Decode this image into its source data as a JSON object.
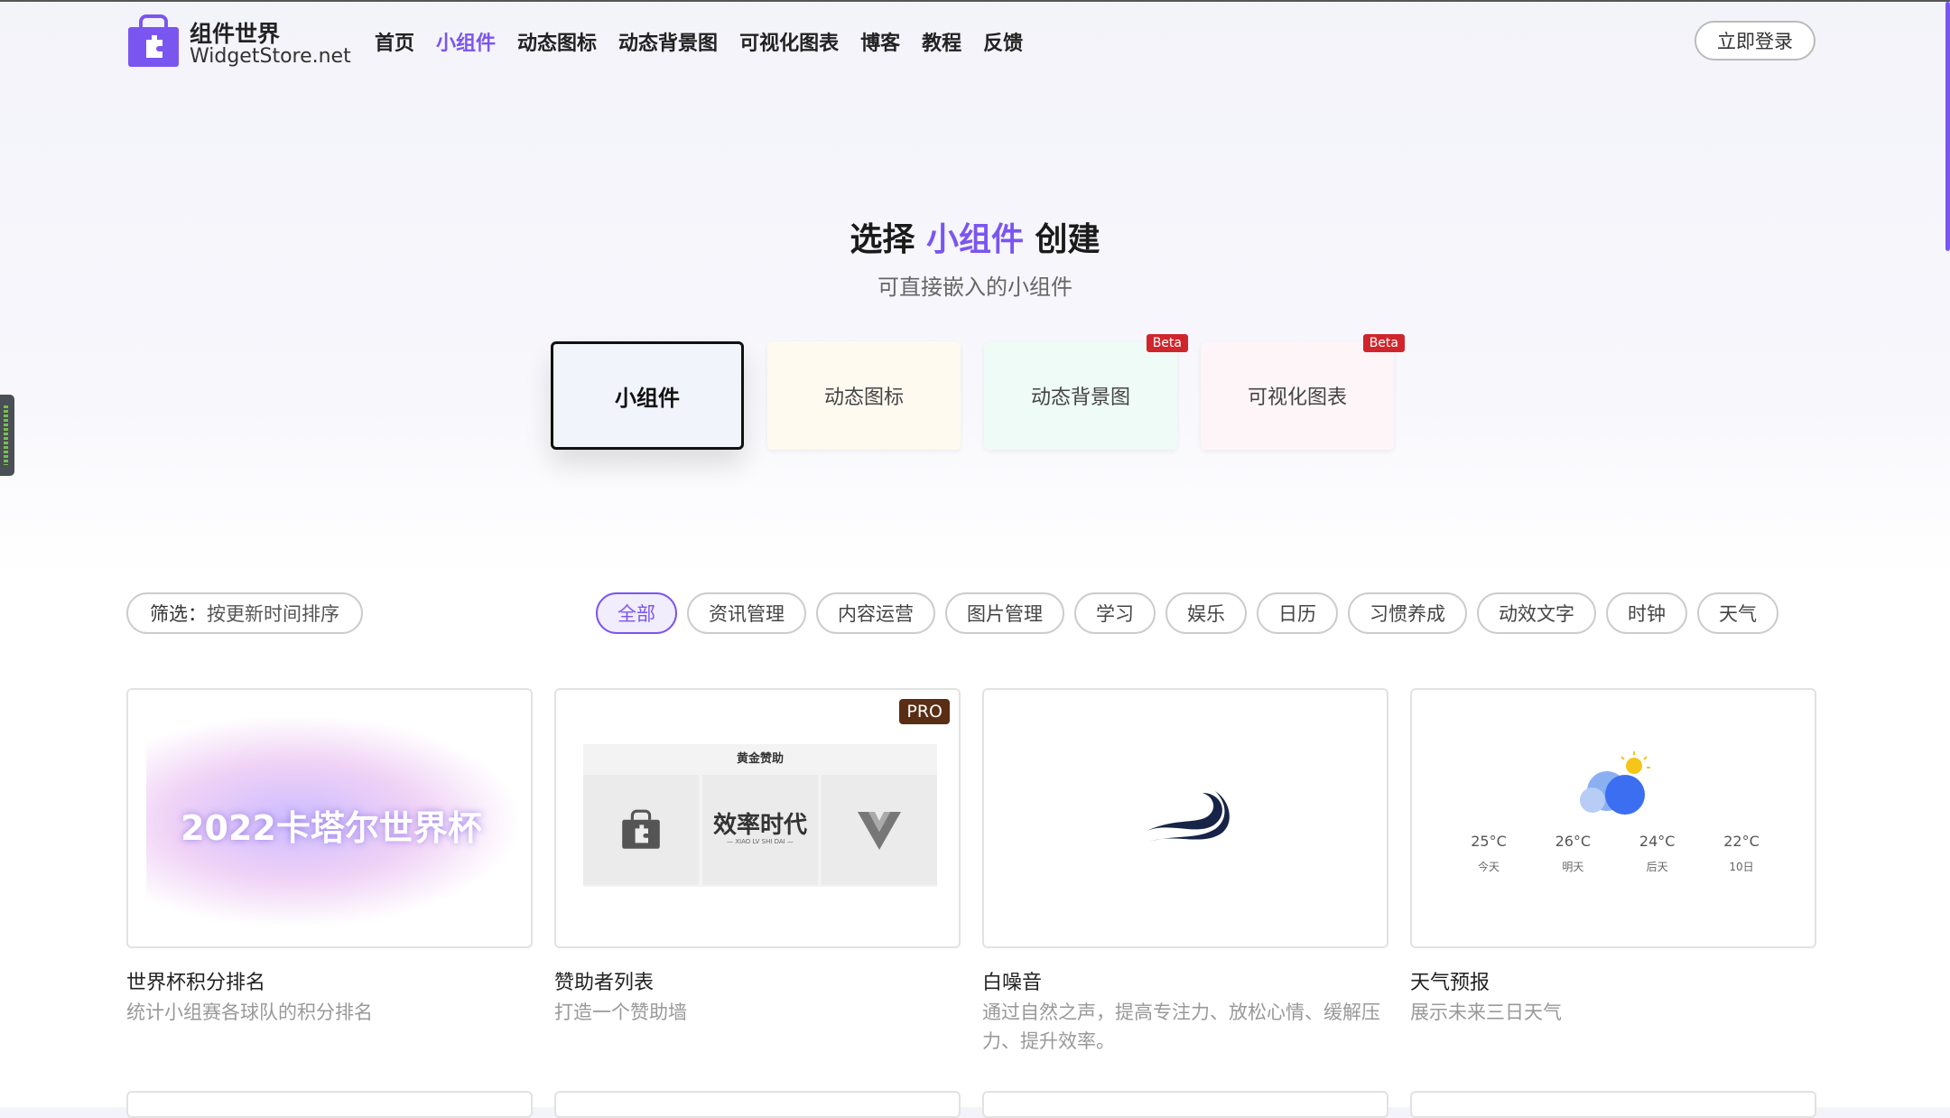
{
  "brand": {
    "title": "组件世界",
    "subtitle": "WidgetStore.net"
  },
  "nav": [
    "首页",
    "小组件",
    "动态图标",
    "动态背景图",
    "可视化图表",
    "博客",
    "教程",
    "反馈"
  ],
  "nav_active": "小组件",
  "header": {
    "login": "立即登录"
  },
  "hero": {
    "title_prefix": "选择",
    "title_highlight": "小组件",
    "title_suffix": "创建",
    "subtitle": "可直接嵌入的小组件"
  },
  "categories": [
    {
      "label": "小组件",
      "badge": "",
      "bg": "#f2f4fc"
    },
    {
      "label": "动态图标",
      "badge": "",
      "bg": "#fffaf0"
    },
    {
      "label": "动态背景图",
      "badge": "Beta",
      "bg": "#effbf6"
    },
    {
      "label": "可视化图表",
      "badge": "Beta",
      "bg": "#fdf5f8"
    }
  ],
  "filter": {
    "label": "筛选：",
    "value": "按更新时间排序"
  },
  "tags": [
    "全部",
    "资讯管理",
    "内容运营",
    "图片管理",
    "学习",
    "娱乐",
    "日历",
    "习惯养成",
    "动效文字",
    "时钟",
    "天气"
  ],
  "tag_active": "全部",
  "widgets": [
    {
      "title": "世界杯积分排名",
      "desc": "统计小组赛各球队的积分排名",
      "preview_text": "2022卡塔尔世界杯"
    },
    {
      "title": "赞助者列表",
      "desc": "打造一个赞助墙",
      "badge": "PRO",
      "preview_heading": "黄金赞助",
      "preview_brand": "效率时代",
      "preview_brand_sub": "— XIAO LV SHI DAI —"
    },
    {
      "title": "白噪音",
      "desc": "通过自然之声，提高专注力、放松心情、缓解压力、提升效率。"
    },
    {
      "title": "天气预报",
      "desc": "展示未来三日天气",
      "forecast": [
        {
          "temp": "25°C",
          "day": "今天"
        },
        {
          "temp": "26°C",
          "day": "明天"
        },
        {
          "temp": "24°C",
          "day": "后天"
        },
        {
          "temp": "22°C",
          "day": "10日"
        }
      ]
    }
  ],
  "colors": {
    "accent": "#7b55f0",
    "beta": "#d0262b",
    "pro": "#5a2e14",
    "wave": "#172447"
  },
  "icons": [
    "bag-logo-icon",
    "wave-icon",
    "cloud-sun-icon",
    "v-logo-icon"
  ]
}
